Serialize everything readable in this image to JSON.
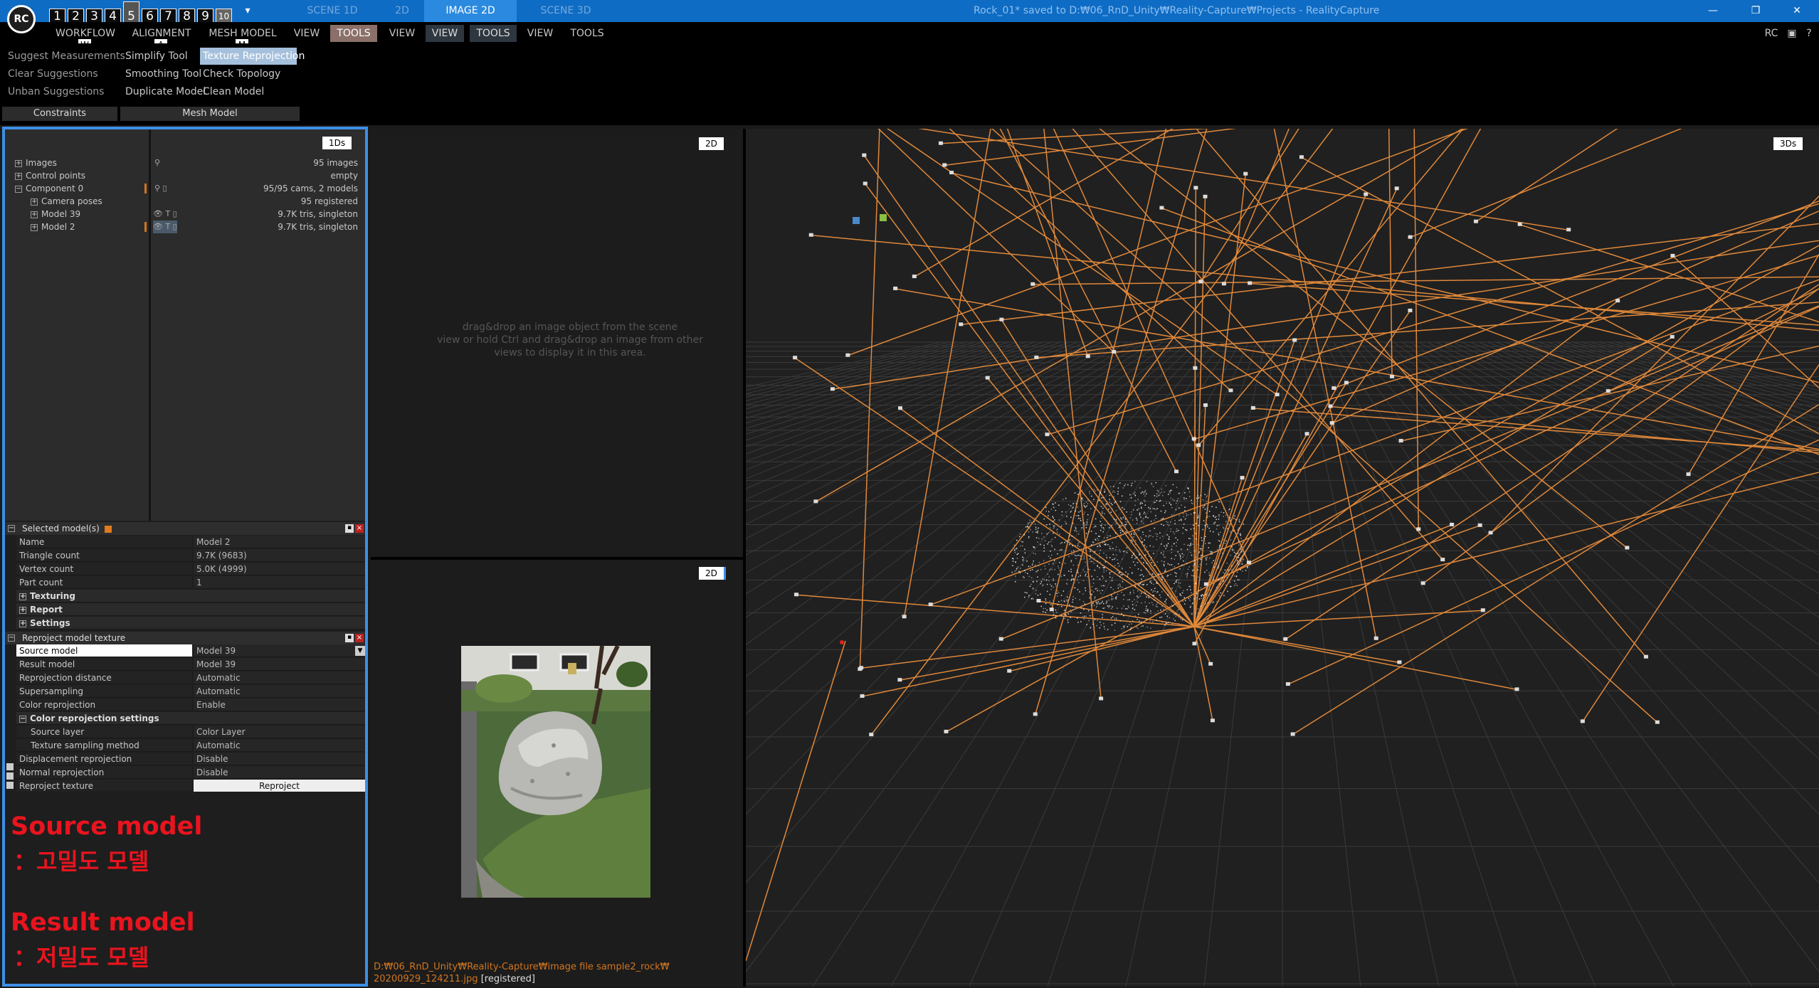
{
  "titlebar": {
    "logo": "RC",
    "layouts": [
      "1",
      "2",
      "3",
      "4",
      "5",
      "6",
      "7",
      "8",
      "9",
      "10"
    ],
    "tabs": [
      "SCENE 1D",
      "2D",
      "IMAGE 2D",
      "SCENE 3D"
    ],
    "dropdown_glyph": "▾",
    "window_title": "Rock_01* saved to D:₩06_RnD_Unity₩Reality-Capture₩Projects - RealityCapture",
    "minimize": "—",
    "restore": "❐",
    "close": "✕"
  },
  "menubar": {
    "items": [
      "WORKFLOW",
      "ALIGNMENT",
      "MESH MODEL",
      "VIEW",
      "TOOLS",
      "VIEW",
      "VIEW",
      "TOOLS",
      "VIEW",
      "TOOLS"
    ],
    "shortcuts": [
      "W",
      "A",
      "M"
    ],
    "right_label": "RC",
    "right_icons": [
      "▣",
      "?"
    ]
  },
  "ribbon": {
    "constraints": [
      "Suggest Measurements",
      "Clear Suggestions",
      "Unban Suggestions"
    ],
    "mesh_left": [
      "Simplify Tool",
      "Smoothing Tool",
      "Duplicate Model"
    ],
    "mesh_right": [
      "Texture Reprojection",
      "Check Topology",
      "Clean Model"
    ],
    "group_constraints": "Constraints",
    "group_mesh": "Mesh Model"
  },
  "tree": {
    "tag": "1Ds",
    "rows": [
      {
        "label": "Images",
        "value": "95 images",
        "icons": "⚲"
      },
      {
        "label": "Control points",
        "value": "empty",
        "icons": ""
      },
      {
        "label": "Component 0",
        "value": "95/95 cams, 2 models",
        "icons": "⚲ ▯"
      },
      {
        "label": "Camera poses",
        "value": "95 registered",
        "icons": ""
      },
      {
        "label": "Model 39",
        "value": "9.7K tris, singleton",
        "icons": "👁 T ▯"
      },
      {
        "label": "Model 2",
        "value": "9.7K tris, singleton",
        "icons": "👁 T ▯"
      }
    ]
  },
  "selected_model": {
    "title": "Selected model(s)",
    "rows": [
      {
        "k": "Name",
        "v": "Model 2"
      },
      {
        "k": "Triangle count",
        "v": "9.7K (9683)"
      },
      {
        "k": "Vertex count",
        "v": "5.0K (4999)"
      },
      {
        "k": "Part count",
        "v": "1"
      }
    ],
    "sections": [
      "Texturing",
      "Report",
      "Settings"
    ]
  },
  "reproject": {
    "title": "Reproject model texture",
    "rows": [
      {
        "k": "Source model",
        "v": "Model 39"
      },
      {
        "k": "Result model",
        "v": "Model 39"
      },
      {
        "k": "Reprojection distance",
        "v": "Automatic"
      },
      {
        "k": "Supersampling",
        "v": "Automatic"
      },
      {
        "k": "Color reprojection",
        "v": "Enable"
      },
      {
        "k": "Color reprojection settings",
        "v": ""
      },
      {
        "k": "Source layer",
        "v": "Color Layer"
      },
      {
        "k": "Texture sampling method",
        "v": "Automatic"
      },
      {
        "k": "Displacement reprojection",
        "v": "Disable"
      },
      {
        "k": "Normal reprojection",
        "v": "Disable"
      },
      {
        "k": "Reproject texture",
        "v": "Reproject"
      }
    ]
  },
  "annotations": {
    "source_title": "Source model",
    "source_desc": "：고밀도 모델",
    "result_title": "Result model",
    "result_desc": "：저밀도 모델"
  },
  "view2d_top": {
    "tag": "2D",
    "hint_line1": "drag&drop an image object from the scene",
    "hint_line2": "view or hold Ctrl and drag&drop an image from other",
    "hint_line3": "views to display it in this area."
  },
  "view2d_bottom": {
    "tag": "2D",
    "path_line1": "D:₩06_RnD_Unity₩Reality-Capture₩image file sample2_rock₩",
    "path_file": "20200929_124211.jpg",
    "path_status": "[registered]"
  },
  "view3d": {
    "tag": "3Ds"
  },
  "colors": {
    "accent_blue": "#0f6cc4",
    "ray_orange": "#e0883a",
    "annotation_red": "#e8141e",
    "panel_border": "#3d8fe6"
  }
}
